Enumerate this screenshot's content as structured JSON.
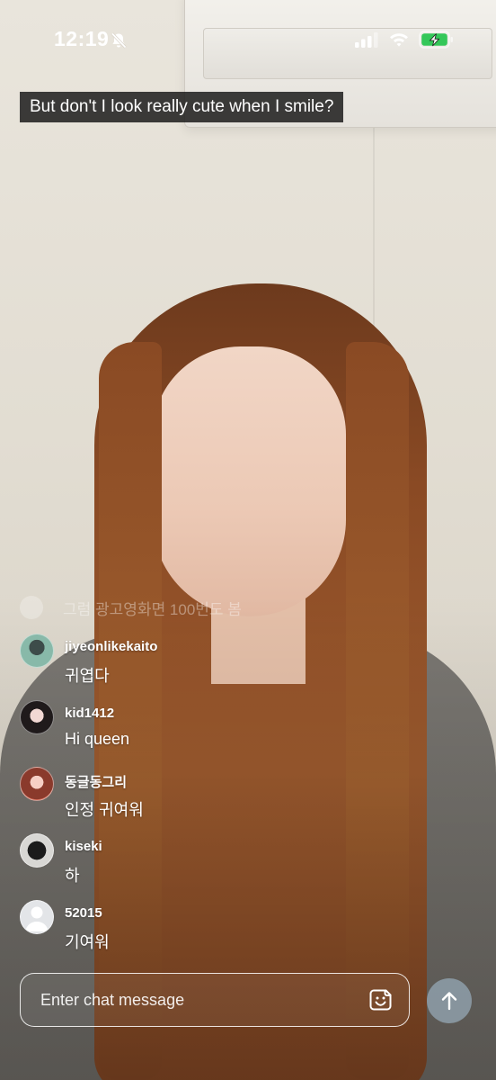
{
  "status_bar": {
    "time": "12:19",
    "icons": [
      "mute-bell-icon",
      "cellular-signal-icon",
      "wifi-icon",
      "battery-charging-icon"
    ],
    "battery_color": "#34c759"
  },
  "caption": {
    "text": "But don't I look really cute when I smile?"
  },
  "chat": {
    "faded_message": "그럼 광고영화면 100번도 봄",
    "messages": [
      {
        "user": "jiyeonlikekaito",
        "text": "귀엽다"
      },
      {
        "user": "kid1412",
        "text": "Hi queen"
      },
      {
        "user": "동글동그리",
        "text": "인정 귀여워"
      },
      {
        "user": "kiseki",
        "text": "하"
      },
      {
        "user": "52015",
        "text": "기여워"
      }
    ]
  },
  "input": {
    "placeholder": "Enter chat message",
    "value": ""
  },
  "colors": {
    "send_button": "#96a8b6",
    "caption_bg": "#141414"
  }
}
